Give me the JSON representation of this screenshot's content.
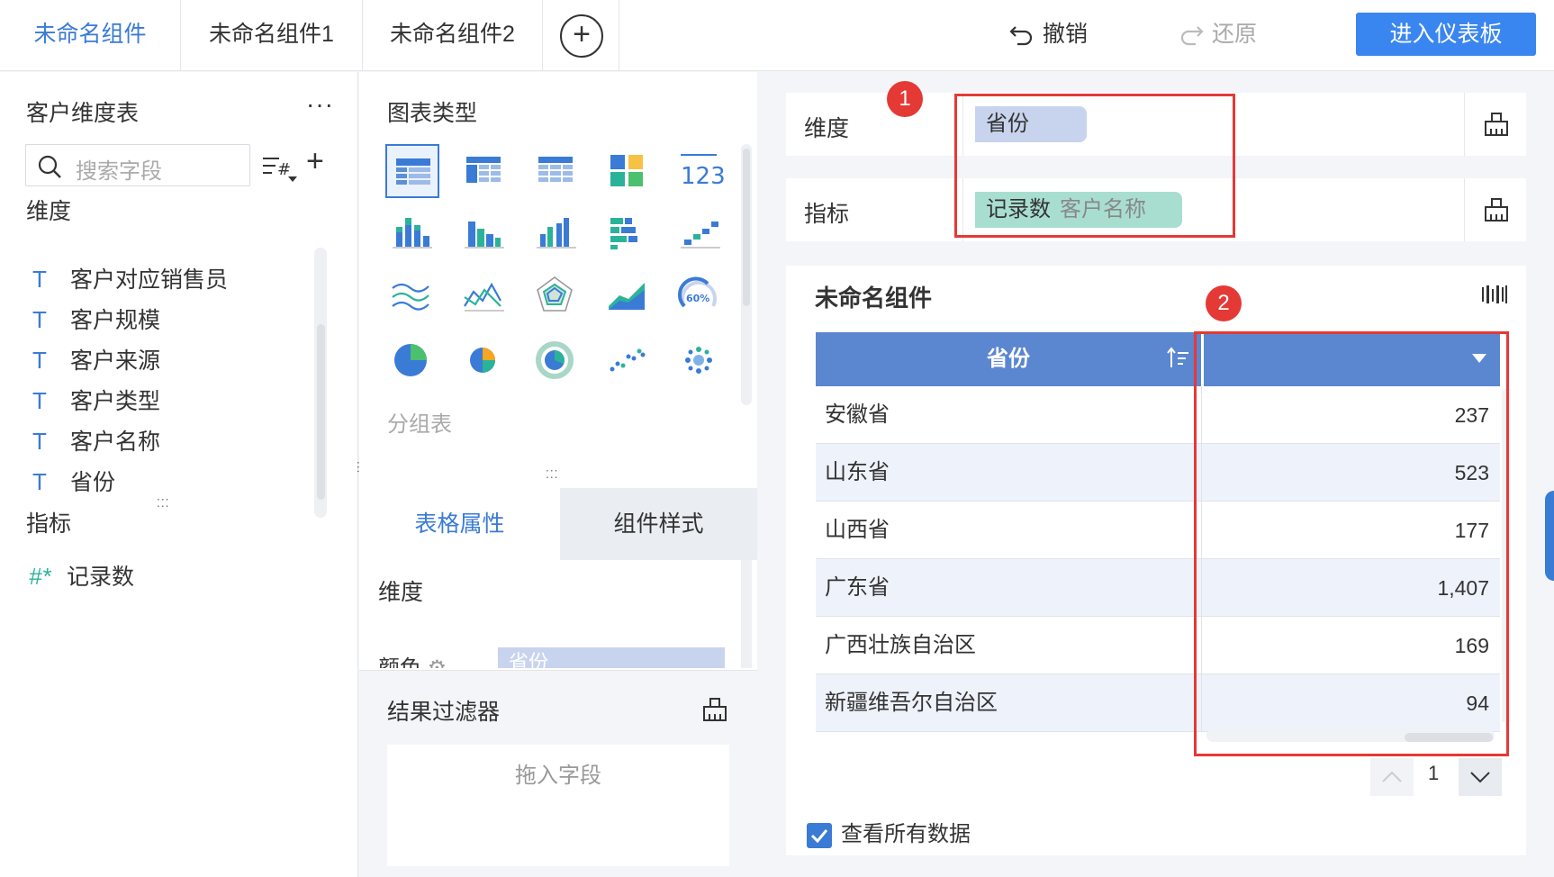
{
  "tabs": [
    {
      "label": "未命名组件",
      "active": true
    },
    {
      "label": "未命名组件1",
      "active": false
    },
    {
      "label": "未命名组件2",
      "active": false
    }
  ],
  "toolbar": {
    "undo_label": "撤销",
    "redo_label": "还原",
    "dashboard_label": "进入仪表板",
    "accent_color": "#3a86f0"
  },
  "left_panel": {
    "title": "客户维度表",
    "more": "···",
    "search_placeholder": "搜索字段",
    "dimension_label": "维度",
    "dimension_fields": [
      {
        "type": "T",
        "label": "客户对应销售员"
      },
      {
        "type": "T",
        "label": "客户规模"
      },
      {
        "type": "T",
        "label": "客户来源"
      },
      {
        "type": "T",
        "label": "客户类型"
      },
      {
        "type": "T",
        "label": "客户名称"
      },
      {
        "type": "T",
        "label": "省份"
      }
    ],
    "measure_label": "指标",
    "measure_fields": [
      {
        "type": "#*",
        "label": "记录数"
      }
    ]
  },
  "chart_panel": {
    "title": "图表类型",
    "group_label": "分组表",
    "icons": [
      "table-icon",
      "cross-table-icon",
      "detail-table-icon",
      "kpi-grid-icon",
      "number-icon",
      "stacked-bar-icon",
      "bar-icon",
      "grouped-bar-icon",
      "bar-group-icon",
      "range-bar-icon",
      "multi-line-icon",
      "line-icon",
      "radar-icon",
      "area-icon",
      "gauge-icon",
      "pie-icon",
      "multi-pie-icon",
      "rose-icon",
      "scatter-icon",
      "bubble-icon"
    ],
    "gauge_text": "60%",
    "number_text": "123"
  },
  "props_tabs": {
    "tab1": "表格属性",
    "tab2": "组件样式"
  },
  "props": {
    "dimension_label": "维度",
    "color_label": "颜色",
    "color_pill": "省份"
  },
  "filter": {
    "title": "结果过滤器",
    "drop_hint": "拖入字段"
  },
  "shelf": {
    "dimension_label": "维度",
    "dimension_pill": "省份",
    "measure_label": "指标",
    "measure_pill": "记录数",
    "measure_pill_sub": "客户名称",
    "badge1": "1",
    "badge2": "2"
  },
  "widget": {
    "title": "未命名组件",
    "column1_header": "省份",
    "rows": [
      {
        "province": "安徽省",
        "count": "237"
      },
      {
        "province": "山东省",
        "count": "523"
      },
      {
        "province": "山西省",
        "count": "177"
      },
      {
        "province": "广东省",
        "count": "1,407"
      },
      {
        "province": "广西壮族自治区",
        "count": "169"
      },
      {
        "province": "新疆维吾尔自治区",
        "count": "94"
      }
    ],
    "page": "1",
    "view_all_label": "查看所有数据",
    "view_all_checked": true
  }
}
